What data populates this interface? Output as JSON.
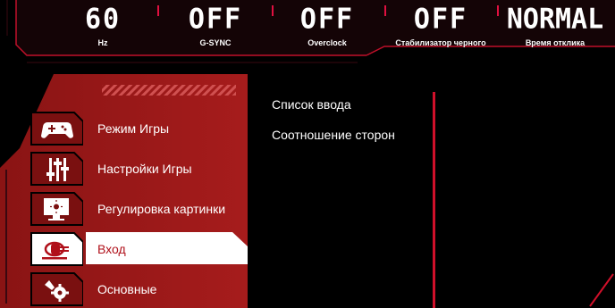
{
  "status_bar": [
    {
      "value": "60",
      "label": "Hz"
    },
    {
      "value": "OFF",
      "label": "G-SYNC"
    },
    {
      "value": "OFF",
      "label": "Overclock"
    },
    {
      "value": "OFF",
      "label": "Стабилизатор черного"
    },
    {
      "value": "NORMAL",
      "label": "Время отклика"
    }
  ],
  "menu": [
    {
      "label": "Режим Игры",
      "icon": "gamepad-icon",
      "active": false
    },
    {
      "label": "Настройки Игры",
      "icon": "sliders-icon",
      "active": false
    },
    {
      "label": "Регулировка картинки",
      "icon": "monitor-brightness-icon",
      "active": false
    },
    {
      "label": "Вход",
      "icon": "input-plug-icon",
      "active": true
    },
    {
      "label": "Основные",
      "icon": "settings-wrench-icon",
      "active": false
    }
  ],
  "submenu": [
    {
      "label": "Список ввода"
    },
    {
      "label": "Соотношение сторон"
    }
  ],
  "colors": {
    "accent": "#e01040",
    "panel": "#9e1c1c",
    "active_bg": "#ffffff",
    "background": "#000000"
  }
}
